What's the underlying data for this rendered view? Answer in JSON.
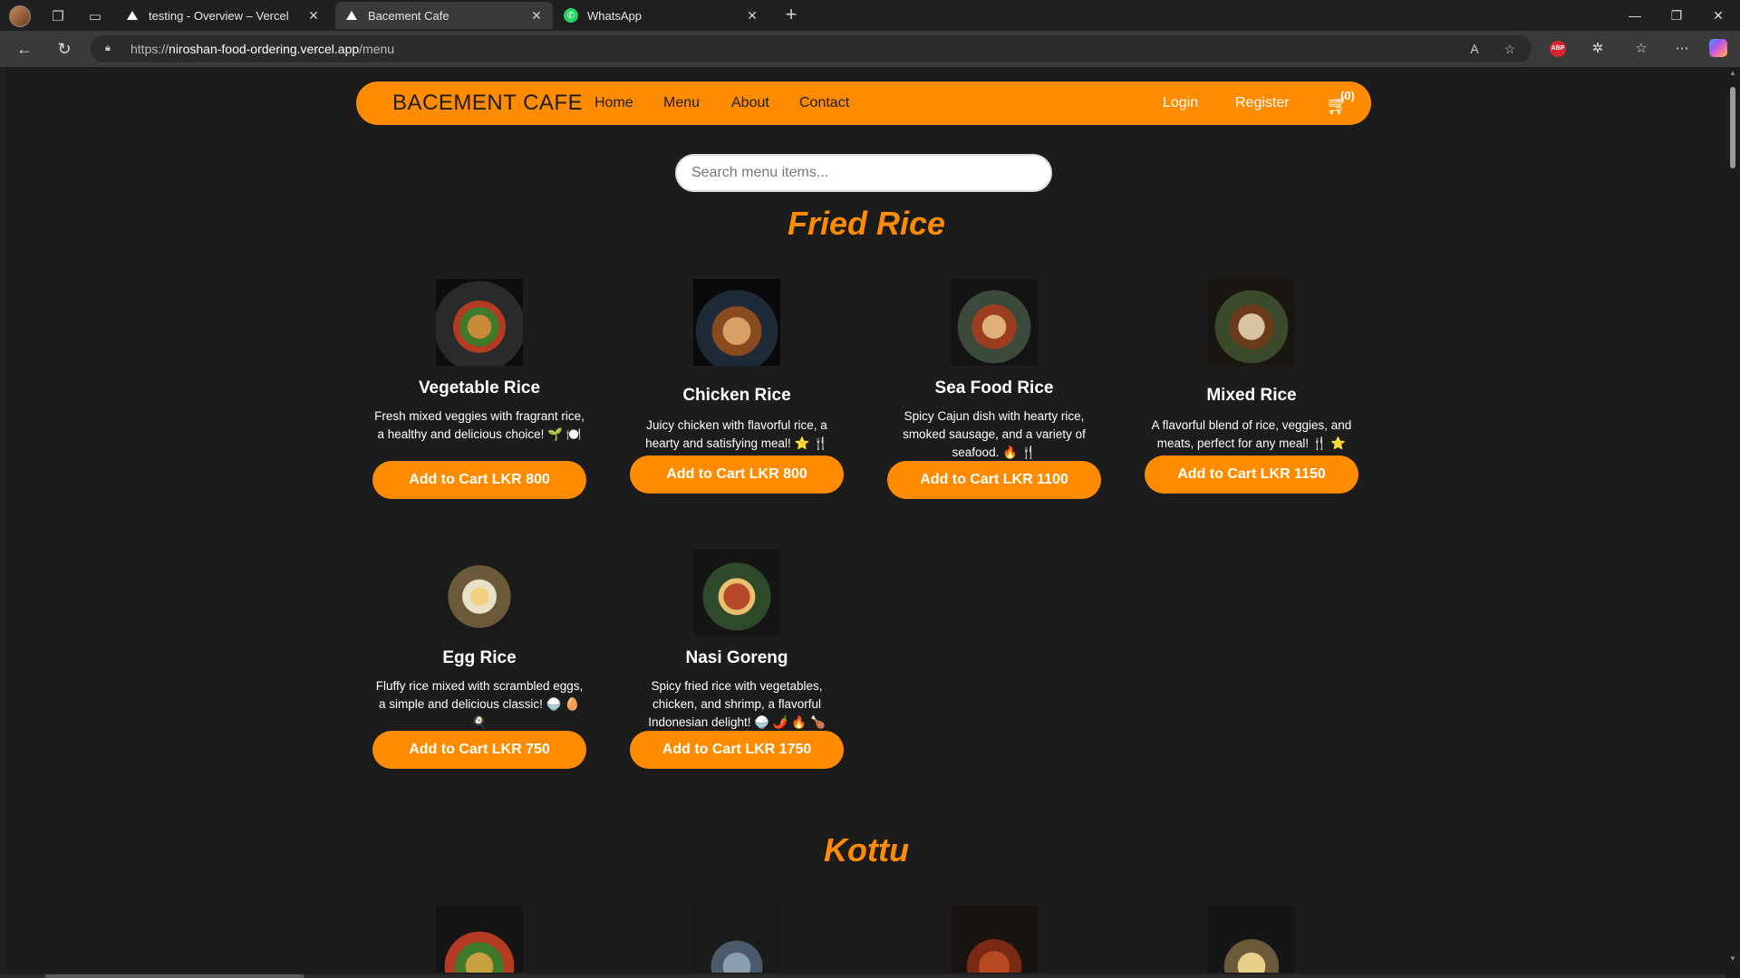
{
  "browser": {
    "tabs": [
      {
        "label": "testing - Overview – Vercel",
        "favicon": "vercel-triangle",
        "active": false
      },
      {
        "label": "Bacement Cafe",
        "favicon": "vercel-triangle",
        "active": true
      },
      {
        "label": "WhatsApp",
        "favicon": "whatsapp-logo",
        "active": false
      }
    ],
    "url_prefix": "https://",
    "url_domain": "niroshan-food-ordering.vercel.app",
    "url_path": "/menu",
    "extension_badge": "ABP"
  },
  "site": {
    "brand": "BACEMENT CAFE",
    "nav": [
      "Home",
      "Menu",
      "About",
      "Contact"
    ],
    "auth": [
      "Login",
      "Register"
    ],
    "cart_count": "(0)",
    "search_placeholder": "Search menu items...",
    "accent_color": "#ff8c00"
  },
  "sections": [
    {
      "title": "Fried Rice",
      "items": [
        {
          "name": "Vegetable Rice",
          "desc": "Fresh mixed veggies with fragrant rice, a healthy and delicious choice! 🌱 🍽️",
          "button": "Add to Cart LKR 800"
        },
        {
          "name": "Chicken Rice",
          "desc": "Juicy chicken with flavorful rice, a hearty and satisfying meal! ⭐ 🍴",
          "button": "Add to Cart LKR 800"
        },
        {
          "name": "Sea Food Rice",
          "desc": "Spicy Cajun dish with hearty rice, smoked sausage, and a variety of seafood. 🔥 🍴",
          "button": "Add to Cart LKR 1100"
        },
        {
          "name": "Mixed Rice",
          "desc": "A flavorful blend of rice, veggies, and meats, perfect for any meal! 🍴 ⭐",
          "button": "Add to Cart LKR 1150"
        },
        {
          "name": "Egg Rice",
          "desc": "Fluffy rice mixed with scrambled eggs, a simple and delicious classic! 🍚 🥚 🍳",
          "button": "Add to Cart LKR 750"
        },
        {
          "name": "Nasi Goreng",
          "desc": "Spicy fried rice with vegetables, chicken, and shrimp, a flavorful Indonesian delight! 🍚 🌶️ 🔥 🍗",
          "button": "Add to Cart LKR 1750"
        }
      ]
    },
    {
      "title": "Kottu",
      "items": []
    }
  ]
}
